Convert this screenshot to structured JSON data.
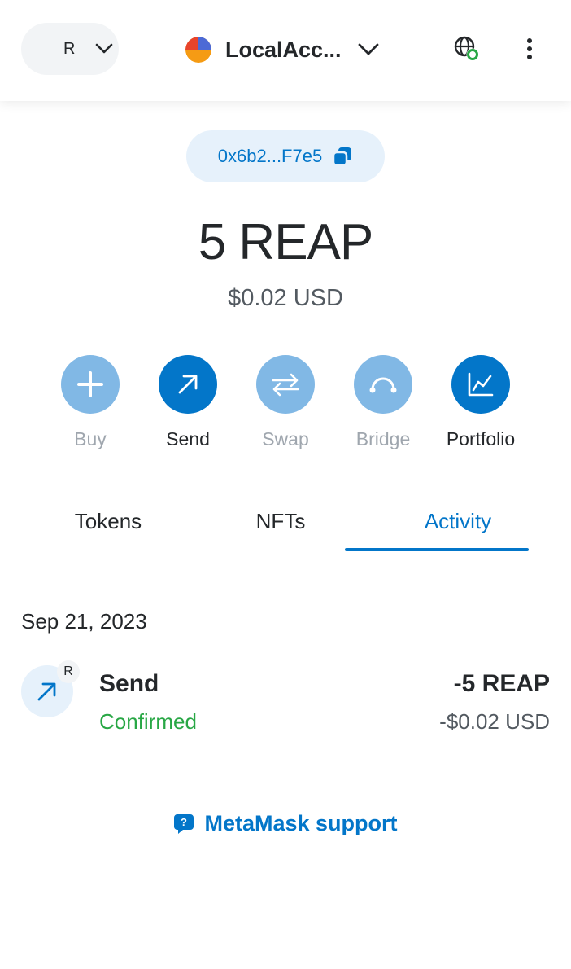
{
  "header": {
    "network_initial": "R",
    "account_name": "LocalAcc...",
    "icons": [
      "chevron-down-icon",
      "globe-connected-icon",
      "kebab-menu-icon"
    ]
  },
  "address": {
    "short": "0x6b2...F7e5",
    "icon": "copy-icon"
  },
  "balance": {
    "primary": "5 REAP",
    "fiat": "$0.02 USD"
  },
  "actions": [
    {
      "label": "Buy",
      "icon": "plus-icon",
      "enabled": false
    },
    {
      "label": "Send",
      "icon": "arrow-up-right-icon",
      "enabled": true
    },
    {
      "label": "Swap",
      "icon": "swap-arrows-icon",
      "enabled": false
    },
    {
      "label": "Bridge",
      "icon": "bridge-icon",
      "enabled": false
    },
    {
      "label": "Portfolio",
      "icon": "chart-icon",
      "enabled": true
    }
  ],
  "tabs": [
    {
      "label": "Tokens",
      "active": false
    },
    {
      "label": "NFTs",
      "active": false
    },
    {
      "label": "Activity",
      "active": true
    }
  ],
  "activity": {
    "date": "Sep 21, 2023",
    "transactions": [
      {
        "badge": "R",
        "title": "Send",
        "status": "Confirmed",
        "amount": "-5 REAP",
        "fiat": "-$0.02 USD"
      }
    ]
  },
  "support": {
    "label": "MetaMask support"
  },
  "colors": {
    "primary": "#0376c9",
    "primary_disabled": "#81b8e5",
    "success": "#28a745",
    "text": "#24272a",
    "muted": "#9fa6ae"
  }
}
